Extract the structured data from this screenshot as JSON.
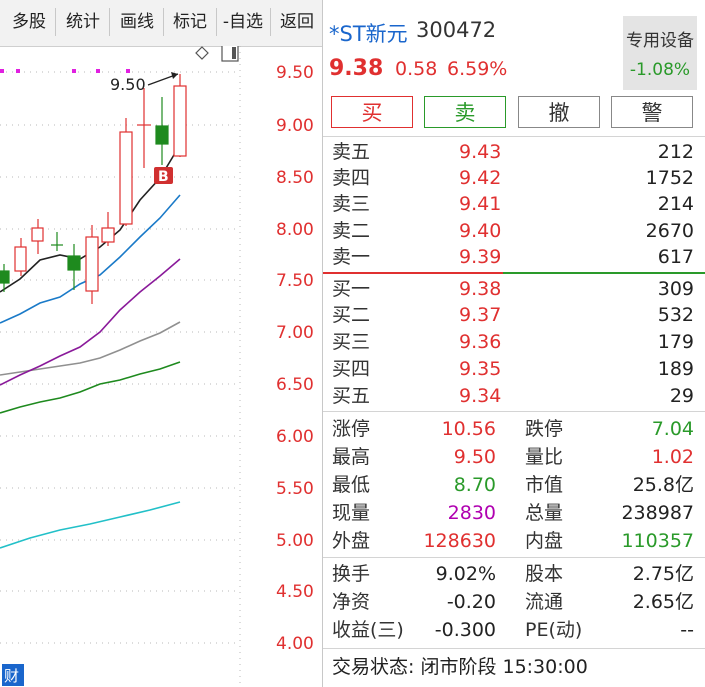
{
  "toolbar": {
    "buttons": [
      "多股",
      "统计",
      "画线",
      "标记",
      "-自选",
      "返回"
    ]
  },
  "chart": {
    "price_labels": [
      "9.50",
      "9.00",
      "8.50",
      "8.00",
      "7.50",
      "7.00",
      "6.50",
      "6.00",
      "5.50",
      "5.00",
      "4.50",
      "4.00"
    ],
    "high_marker": "9.50",
    "buy_marker": "B",
    "corner_icon": "财",
    "colors": {
      "up": "#e03030",
      "down": "#1e8a1e",
      "ma5": "#222222",
      "ma10": "#1a7ac8",
      "ma20": "#8a1a9a",
      "ma30": "#909090",
      "ma60": "#1e8a1e",
      "ma120": "#22c0c8"
    }
  },
  "header": {
    "name": "*ST新元",
    "code": "300472",
    "price": "9.38",
    "change": "0.58",
    "change_pct": "6.59%",
    "sector_name": "专用设备",
    "sector_pct": "-1.08%"
  },
  "trade_buttons": [
    "买",
    "卖",
    "撤",
    "警"
  ],
  "asks": [
    {
      "label": "卖五",
      "price": "9.43",
      "vol": "212"
    },
    {
      "label": "卖四",
      "price": "9.42",
      "vol": "1752"
    },
    {
      "label": "卖三",
      "price": "9.41",
      "vol": "214"
    },
    {
      "label": "卖二",
      "price": "9.40",
      "vol": "2670"
    },
    {
      "label": "卖一",
      "price": "9.39",
      "vol": "617"
    }
  ],
  "bids": [
    {
      "label": "买一",
      "price": "9.38",
      "vol": "309"
    },
    {
      "label": "买二",
      "price": "9.37",
      "vol": "532"
    },
    {
      "label": "买三",
      "price": "9.36",
      "vol": "179"
    },
    {
      "label": "买四",
      "price": "9.35",
      "vol": "189"
    },
    {
      "label": "买五",
      "price": "9.34",
      "vol": "29"
    }
  ],
  "stats": [
    {
      "l1": "涨停",
      "v1": "10.56",
      "l2": "跌停",
      "v2": "7.04"
    },
    {
      "l1": "最高",
      "v1": "9.50",
      "l2": "量比",
      "v2": "1.02"
    },
    {
      "l1": "最低",
      "v1": "8.70",
      "l2": "市值",
      "v2": "25.8亿"
    },
    {
      "l1": "现量",
      "v1": "2830",
      "l2": "总量",
      "v2": "238987"
    },
    {
      "l1": "外盘",
      "v1": "128630",
      "l2": "内盘",
      "v2": "110357"
    }
  ],
  "fund": [
    {
      "l1": "换手",
      "v1": "9.02%",
      "l2": "股本",
      "v2": "2.75亿"
    },
    {
      "l1": "净资",
      "v1": "-0.20",
      "l2": "流通",
      "v2": "2.65亿"
    },
    {
      "l1": "收益(三)",
      "v1": "-0.300",
      "l2": "PE(动)",
      "v2": "--"
    }
  ],
  "status": "交易状态: 闭市阶段 15:30:00"
}
